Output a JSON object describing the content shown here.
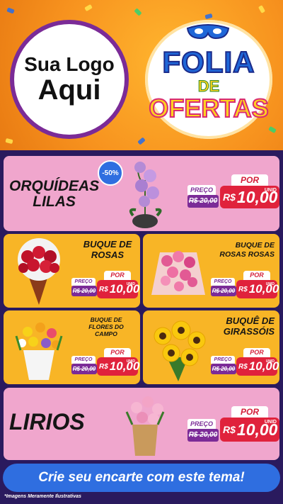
{
  "header": {
    "logo_line1": "Sua Logo",
    "logo_line2": "Aqui",
    "badge_line1": "FOLIA",
    "badge_line2": "DE",
    "badge_line3": "OFERTAS"
  },
  "colors": {
    "pink_card": "#f0a6cd",
    "yellow_card": "#f8b526",
    "price_red": "#e0223c",
    "old_price_purple": "#7b2b97",
    "cta_blue": "#2f6ee0"
  },
  "products": [
    {
      "title_lines": [
        "ORQUÍDEAS",
        "LILAS"
      ],
      "discount": "-50%",
      "preco_label": "PREÇO",
      "old_price": "R$ 20,00",
      "por_label": "POR",
      "currency": "R$",
      "price": "10,00",
      "unit": "UNID"
    },
    {
      "title_lines": [
        "BUQUE DE",
        "ROSAS"
      ],
      "preco_label": "PREÇO",
      "old_price": "R$ 20,00",
      "por_label": "POR",
      "currency": "R$",
      "price": "10,00",
      "unit": "UNID"
    },
    {
      "title_lines": [
        "BUQUE DE",
        "ROSAS ROSAS"
      ],
      "preco_label": "PREÇO",
      "old_price": "R$ 20,00",
      "por_label": "POR",
      "currency": "R$",
      "price": "10,00",
      "unit": "UNID"
    },
    {
      "title_lines": [
        "BUQUE DE",
        "FLORES DO",
        "CAMPO"
      ],
      "preco_label": "PREÇO",
      "old_price": "R$ 20,00",
      "por_label": "POR",
      "currency": "R$",
      "price": "10,00",
      "unit": "UNID"
    },
    {
      "title_lines": [
        "BUQUÊ DE",
        "GIRASSÓIS"
      ],
      "preco_label": "PREÇO",
      "old_price": "R$ 20,00",
      "por_label": "POR",
      "currency": "R$",
      "price": "10,00",
      "unit": "UNID"
    },
    {
      "title_lines": [
        "LIRIOS"
      ],
      "preco_label": "PREÇO",
      "old_price": "R$ 20,00",
      "por_label": "POR",
      "currency": "R$",
      "price": "10,00",
      "unit": "UNID"
    }
  ],
  "cta": "Crie seu encarte com este tema!",
  "footnote": "*Imagens Meramente Ilustrativas"
}
